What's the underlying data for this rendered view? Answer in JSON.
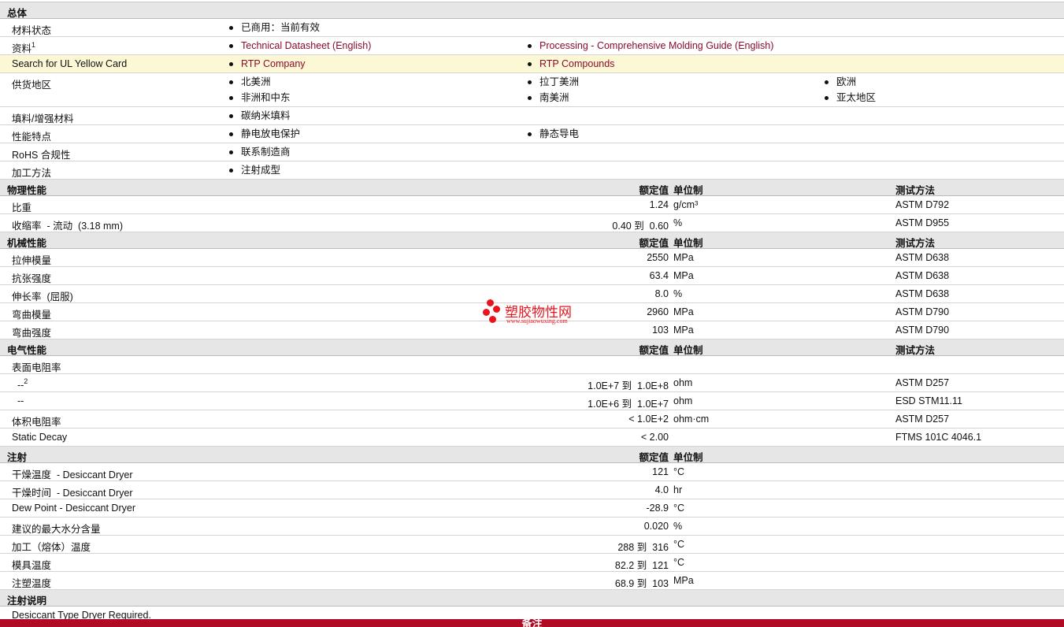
{
  "headers": {
    "value": "额定值",
    "unit": "单位制",
    "method": "测试方法"
  },
  "sections": [
    {
      "title": "总体",
      "kind": "general",
      "rows": [
        {
          "label": "材料状态",
          "items": [
            {
              "text": "已商用：当前有效"
            }
          ]
        },
        {
          "label": "资料",
          "sup": "1",
          "items": [
            {
              "text": "Technical Datasheet (English)",
              "link": true
            },
            {
              "text": "Processing - Comprehensive Molding Guide (English)",
              "link": true
            }
          ]
        },
        {
          "label": "Search for UL Yellow Card",
          "highlight": true,
          "items": [
            {
              "text": "RTP Company",
              "link": true
            },
            {
              "text": "RTP Compounds",
              "link": true
            }
          ]
        },
        {
          "label": "供货地区",
          "items": [
            {
              "text": "北美洲"
            },
            {
              "text": "拉丁美洲"
            },
            {
              "text": "欧洲"
            },
            {
              "text": "非洲和中东"
            },
            {
              "text": "南美洲"
            },
            {
              "text": "亚太地区"
            }
          ]
        },
        {
          "label": "填料/增强材料",
          "items": [
            {
              "text": "碳纳米填料"
            }
          ]
        },
        {
          "label": "性能特点",
          "items": [
            {
              "text": "静电放电保护"
            },
            {
              "text": "静态导电"
            }
          ]
        },
        {
          "label": "RoHS 合规性",
          "items": [
            {
              "text": "联系制造商"
            }
          ]
        },
        {
          "label": "加工方法",
          "items": [
            {
              "text": "注射成型"
            }
          ]
        }
      ]
    },
    {
      "title": "物理性能",
      "kind": "prop",
      "showMethod": true,
      "rows": [
        {
          "label": "比重",
          "value": "1.24",
          "unit": "g/cm³",
          "method": "ASTM D792"
        },
        {
          "label": "收缩率  - 流动  (3.18 mm)",
          "value": "0.40 到  0.60",
          "unit": "%",
          "method": "ASTM D955"
        }
      ]
    },
    {
      "title": "机械性能",
      "kind": "prop",
      "showMethod": true,
      "rows": [
        {
          "label": "拉伸模量",
          "value": "2550",
          "unit": "MPa",
          "method": "ASTM D638"
        },
        {
          "label": "抗张强度",
          "value": "63.4",
          "unit": "MPa",
          "method": "ASTM D638"
        },
        {
          "label": "伸长率  (屈服)",
          "value": "8.0",
          "unit": "%",
          "method": "ASTM D638"
        },
        {
          "label": "弯曲模量",
          "value": "2960",
          "unit": "MPa",
          "method": "ASTM D790"
        },
        {
          "label": "弯曲强度",
          "value": "103",
          "unit": "MPa",
          "method": "ASTM D790"
        }
      ]
    },
    {
      "title": "电气性能",
      "kind": "prop",
      "showMethod": true,
      "rows": [
        {
          "label": "表面电阻率"
        },
        {
          "label": "  --",
          "sup": "2",
          "value": "1.0E+7 到  1.0E+8",
          "unit": "ohm",
          "method": "ASTM D257"
        },
        {
          "label": "  --",
          "value": "1.0E+6 到  1.0E+7",
          "unit": "ohm",
          "method": "ESD STM11.11"
        },
        {
          "label": "体积电阻率",
          "value": "< 1.0E+2",
          "unit": "ohm·cm",
          "method": "ASTM D257"
        },
        {
          "label": "Static Decay",
          "value": "< 2.00",
          "method": "FTMS 101C 4046.1"
        }
      ]
    },
    {
      "title": "注射",
      "kind": "prop",
      "showMethod": false,
      "rows": [
        {
          "label": "干燥温度  - Desiccant Dryer",
          "value": "121",
          "unit": "°C"
        },
        {
          "label": "干燥时间  - Desiccant Dryer",
          "value": "4.0",
          "unit": "hr"
        },
        {
          "label": "Dew Point - Desiccant Dryer",
          "value": "-28.9",
          "unit": "°C"
        },
        {
          "label": "建议的最大水分含量",
          "value": "0.020",
          "unit": "%"
        },
        {
          "label": "加工（熔体）温度",
          "value": "288 到  316",
          "unit": "°C"
        },
        {
          "label": "模具温度",
          "value": "82.2 到  121",
          "unit": "°C"
        },
        {
          "label": "注塑温度",
          "value": "68.9 到  103",
          "unit": "MPa"
        }
      ]
    },
    {
      "title": "注射说明",
      "kind": "note",
      "rows": [
        {
          "label": "Desiccant Type Dryer Required."
        }
      ]
    }
  ],
  "footer": {
    "title": "备注"
  },
  "watermark": {
    "name": "塑胶物性网",
    "url": "www.sujiaowuxing.com"
  },
  "colors": {
    "link": "#8a0c2c",
    "footer": "#b10a26",
    "highlight": "#fcf8d6",
    "section": "#e6e6e6"
  }
}
